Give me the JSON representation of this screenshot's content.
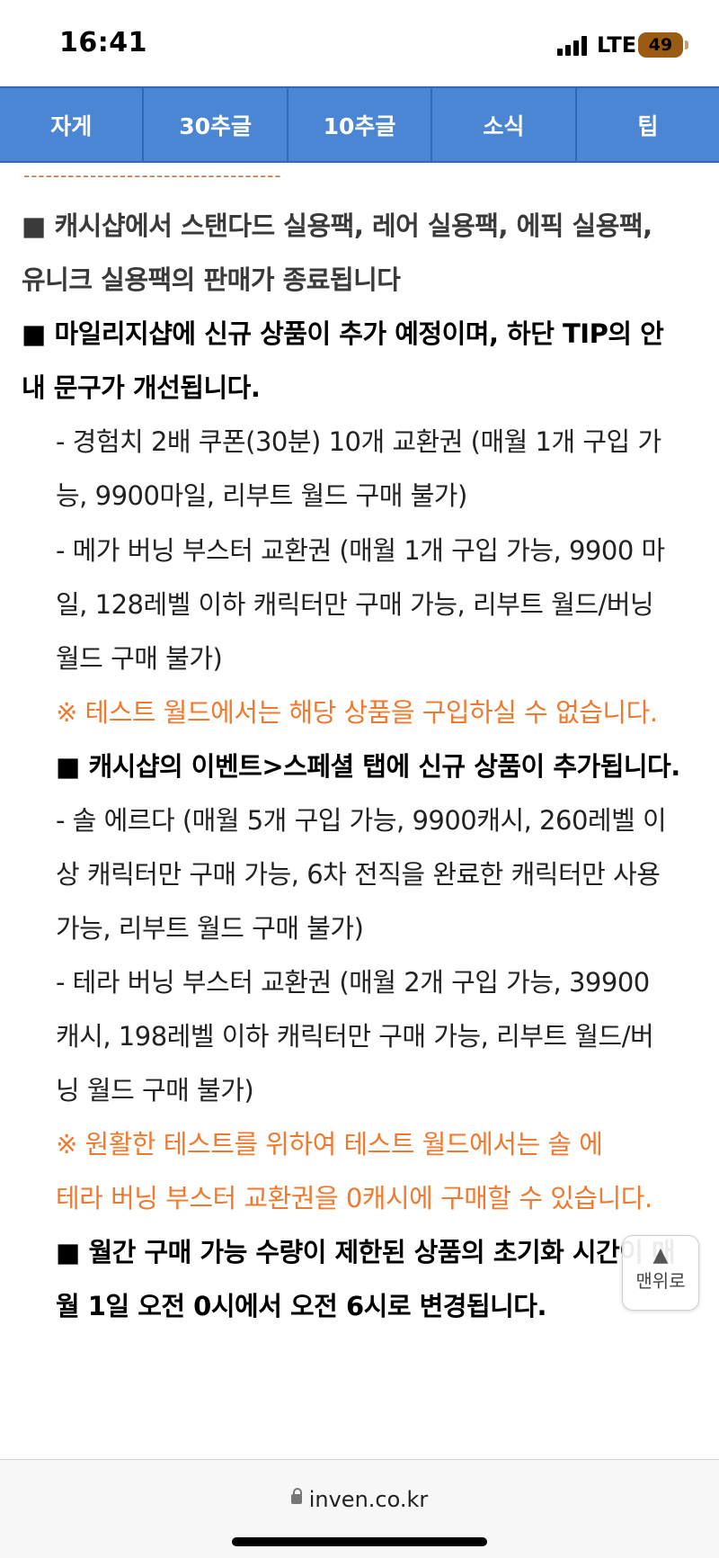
{
  "status": {
    "time": "16:41",
    "network": "LTE",
    "battery": "49"
  },
  "tabs": [
    "자게",
    "30추글",
    "10추글",
    "소식",
    "팁"
  ],
  "content": {
    "divider": "-----------------------------------",
    "lines": [
      {
        "text": "■ 캐시샵에서 스탠다드 실용팩, 레어 실용팩, 에픽 실용팩,",
        "style": "gray"
      },
      {
        "text": "유니크 실용팩의 판매가 종료됩니다",
        "style": "gray"
      },
      {
        "text": "■ 마일리지샵에 신규 상품이 추가 예정이며, 하단 TIP의 안",
        "style": "blk"
      },
      {
        "text": "내 문구가 개선됩니다.",
        "style": "blk"
      },
      {
        "text": "- 경험치 2배 쿠폰(30분) 10개 교환권 (매월 1개 구입 가",
        "style": "norm"
      },
      {
        "text": "능, 9900마일, 리부트 월드 구매 불가)",
        "style": "norm"
      },
      {
        "text": "- 메가 버닝 부스터 교환권 (매월 1개 구입 가능, 9900 마",
        "style": "norm"
      },
      {
        "text": "일, 128레벨 이하 캐릭터만 구매 가능, 리부트 월드/버닝",
        "style": "norm"
      },
      {
        "text": "월드 구매 불가)",
        "style": "norm"
      },
      {
        "text": "※ 테스트 월드에서는 해당 상품을 구입하실 수 없습니다.",
        "style": "orange"
      },
      {
        "text": "■ 캐시샵의 이벤트>스페셜 탭에 신규 상품이 추가됩니다.",
        "style": "blk"
      },
      {
        "text": "- 솔 에르다 (매월 5개 구입 가능, 9900캐시, 260레벨 이",
        "style": "norm"
      },
      {
        "text": "상 캐릭터만 구매 가능, 6차 전직을 완료한 캐릭터만 사용",
        "style": "norm"
      },
      {
        "text": "가능, 리부트 월드 구매 불가)",
        "style": "norm"
      },
      {
        "text": "- 테라 버닝 부스터 교환권 (매월 2개 구입 가능, 39900",
        "style": "norm"
      },
      {
        "text": "캐시, 198레벨 이하 캐릭터만 구매 가능, 리부트 월드/버",
        "style": "norm"
      },
      {
        "text": "닝 월드 구매 불가)",
        "style": "norm"
      },
      {
        "text": "※ 원활한 테스트를 위하여 테스트 월드에서는 솔 에",
        "style": "orange"
      },
      {
        "text": "테라 버닝 부스터 교환권을 0캐시에 구매할 수 있습니다.",
        "style": "orange"
      },
      {
        "text": "■ 월간 구매 가능 수량이 제한된 상품의 초기화 시간이 매",
        "style": "blk"
      },
      {
        "text": "월 1일 오전 0시에서 오전 6시로 변경됩니다.",
        "style": "blk"
      }
    ]
  },
  "top_button": {
    "arrow": "▲",
    "label": "맨위로"
  },
  "url": "inven.co.kr"
}
